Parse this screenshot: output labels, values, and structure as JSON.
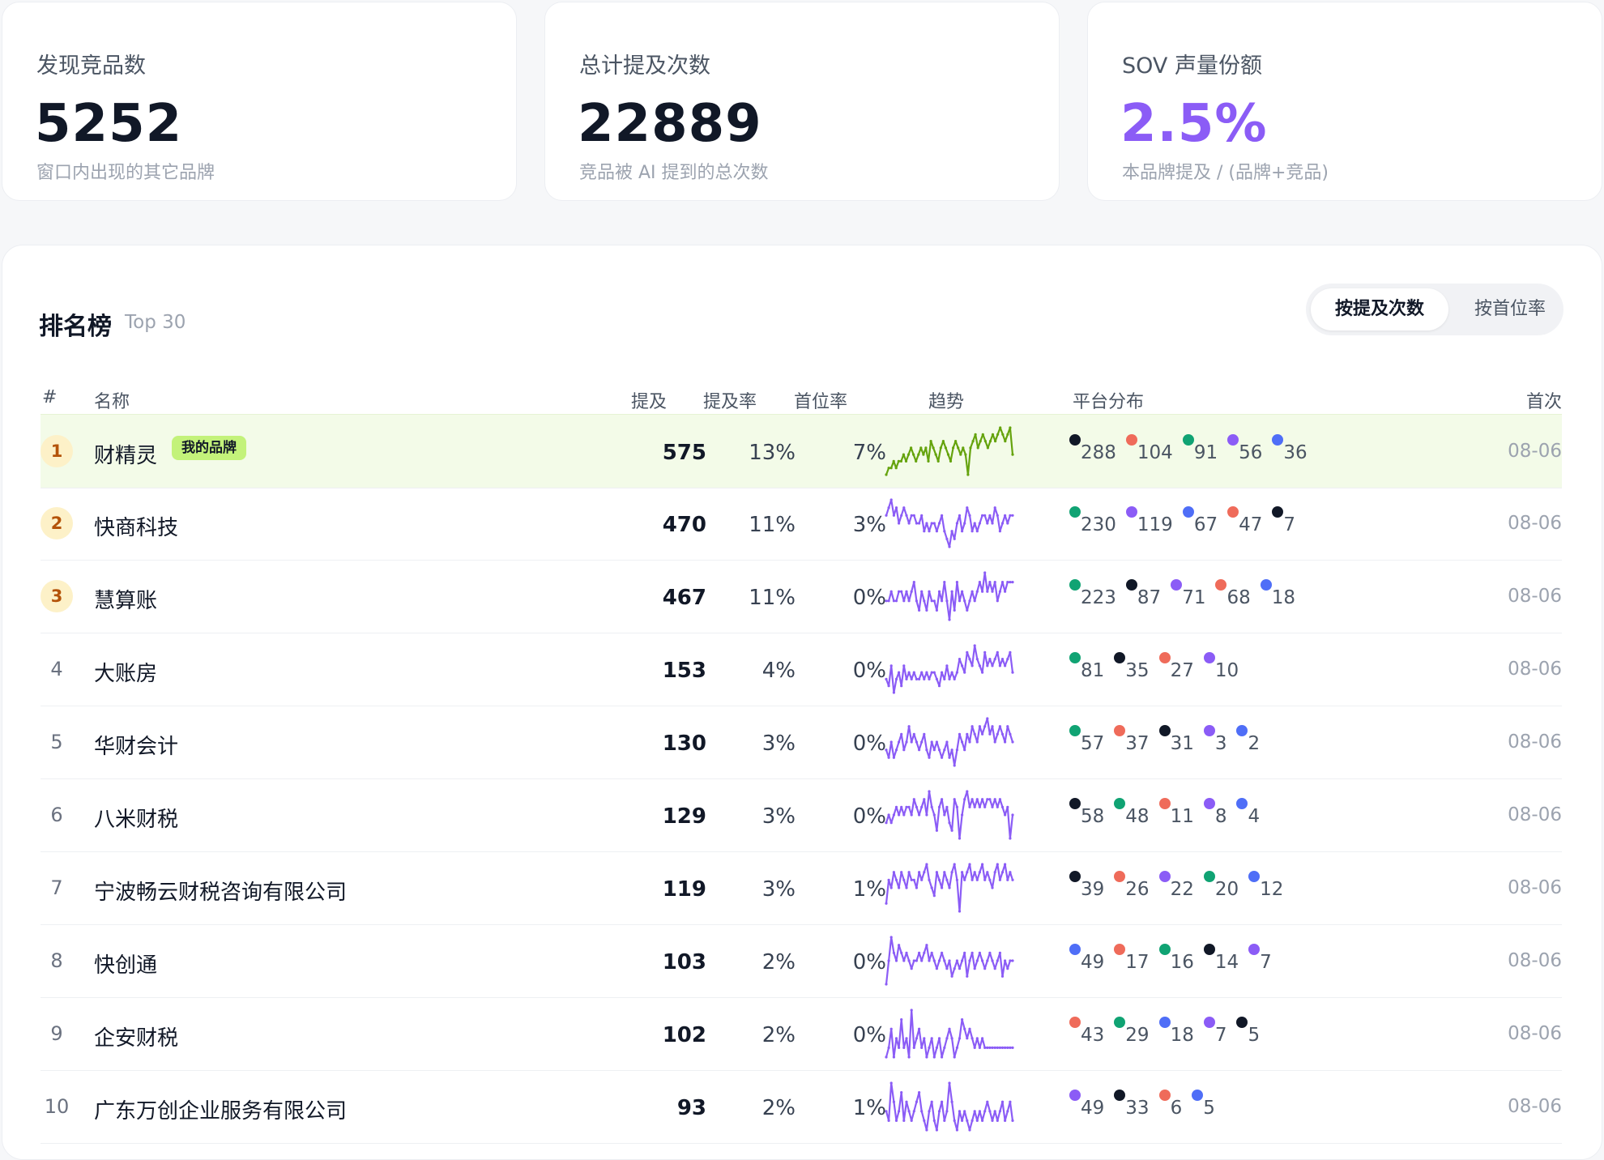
{
  "colors": {
    "black": "#111827",
    "red": "#ef6b5a",
    "green": "#10a373",
    "purple": "#8b5cf6",
    "blue": "#4f6ef7",
    "accent": "#8b5cf6",
    "my_brand_line": "#65a30d",
    "other_line": "#8b5cf6"
  },
  "stats": [
    {
      "label": "发现竞品数",
      "value": "5252",
      "sub": "窗口内出现的其它品牌"
    },
    {
      "label": "总计提及次数",
      "value": "22889",
      "sub": "竞品被 AI 提到的总次数"
    },
    {
      "label": "SOV 声量份额",
      "value": "2.5%",
      "sub": "本品牌提及 / (品牌+竞品)"
    }
  ],
  "ranking": {
    "title": "排名榜",
    "tag": "Top 30",
    "sort_options": [
      "按提及次数",
      "按首位率"
    ],
    "headers": {
      "rank": "#",
      "name": "名称",
      "mentions": "提及",
      "rate": "提及率",
      "first_rate": "首位率",
      "trend": "趋势",
      "platforms": "平台分布",
      "first": "首次"
    },
    "my_brand_badge": "我的品牌",
    "rows": [
      {
        "rank": "1",
        "name": "财精灵",
        "mine": true,
        "mentions": "575",
        "rate": "13%",
        "first_rate": "7%",
        "date": "08-06",
        "trend": [
          3,
          4,
          4,
          5,
          4,
          5,
          5,
          6,
          5,
          6,
          7,
          6,
          5,
          6,
          7,
          6,
          7,
          5,
          8,
          7,
          6,
          5,
          7,
          8,
          7,
          6,
          5,
          7,
          8,
          7,
          6,
          7,
          6,
          3,
          7,
          8,
          9,
          7,
          8,
          9,
          8,
          7,
          8,
          9,
          8,
          9,
          10,
          9,
          8,
          9,
          10,
          6
        ],
        "platforms": [
          {
            "c": "black",
            "v": "288"
          },
          {
            "c": "red",
            "v": "104"
          },
          {
            "c": "green",
            "v": "91"
          },
          {
            "c": "purple",
            "v": "56"
          },
          {
            "c": "blue",
            "v": "36"
          }
        ]
      },
      {
        "rank": "2",
        "name": "快商科技",
        "mentions": "470",
        "rate": "11%",
        "first_rate": "3%",
        "date": "08-06",
        "trend": [
          7,
          8,
          9,
          7,
          8,
          6,
          7,
          8,
          7,
          6,
          7,
          7,
          6,
          6,
          7,
          5,
          6,
          5,
          6,
          6,
          5,
          6,
          7,
          5,
          4,
          3,
          5,
          4,
          6,
          7,
          5,
          6,
          8,
          7,
          5,
          6,
          5,
          6,
          7,
          7,
          6,
          7,
          6,
          8,
          7,
          5,
          6,
          7,
          6,
          7,
          7
        ],
        "platforms": [
          {
            "c": "green",
            "v": "230"
          },
          {
            "c": "purple",
            "v": "119"
          },
          {
            "c": "blue",
            "v": "67"
          },
          {
            "c": "red",
            "v": "47"
          },
          {
            "c": "black",
            "v": "7"
          }
        ]
      },
      {
        "rank": "3",
        "name": "慧算账",
        "mentions": "467",
        "rate": "11%",
        "first_rate": "0%",
        "date": "08-06",
        "trend": [
          6,
          6,
          7,
          6,
          6,
          7,
          7,
          6,
          7,
          6,
          7,
          8,
          6,
          5,
          7,
          6,
          5,
          7,
          6,
          6,
          5,
          7,
          6,
          8,
          6,
          4,
          7,
          5,
          8,
          6,
          7,
          6,
          5,
          6,
          7,
          6,
          7,
          8,
          7,
          9,
          7,
          8,
          7,
          8,
          6,
          7,
          8,
          7,
          8,
          8,
          8
        ],
        "platforms": [
          {
            "c": "green",
            "v": "223"
          },
          {
            "c": "black",
            "v": "87"
          },
          {
            "c": "purple",
            "v": "71"
          },
          {
            "c": "red",
            "v": "68"
          },
          {
            "c": "blue",
            "v": "18"
          }
        ]
      },
      {
        "rank": "4",
        "name": "大账房",
        "mentions": "153",
        "rate": "4%",
        "first_rate": "0%",
        "date": "08-06",
        "trend": [
          5,
          4,
          7,
          3,
          5,
          6,
          4,
          7,
          5,
          6,
          5,
          6,
          5,
          5,
          6,
          5,
          6,
          5,
          6,
          6,
          5,
          4,
          6,
          5,
          7,
          5,
          6,
          5,
          6,
          8,
          7,
          6,
          9,
          8,
          7,
          10,
          8,
          7,
          6,
          9,
          7,
          8,
          7,
          8,
          9,
          7,
          8,
          7,
          8,
          9,
          6
        ],
        "platforms": [
          {
            "c": "green",
            "v": "81"
          },
          {
            "c": "black",
            "v": "35"
          },
          {
            "c": "red",
            "v": "27"
          },
          {
            "c": "purple",
            "v": "10"
          }
        ]
      },
      {
        "rank": "5",
        "name": "华财会计",
        "mentions": "130",
        "rate": "3%",
        "first_rate": "0%",
        "date": "08-06",
        "trend": [
          6,
          5,
          7,
          5,
          6,
          7,
          8,
          6,
          7,
          9,
          7,
          8,
          7,
          6,
          7,
          8,
          6,
          5,
          7,
          6,
          7,
          6,
          5,
          6,
          7,
          5,
          6,
          4,
          6,
          8,
          7,
          6,
          8,
          7,
          9,
          8,
          7,
          9,
          8,
          9,
          10,
          8,
          9,
          7,
          8,
          9,
          8,
          7,
          9,
          8,
          7
        ],
        "platforms": [
          {
            "c": "green",
            "v": "57"
          },
          {
            "c": "red",
            "v": "37"
          },
          {
            "c": "black",
            "v": "31"
          },
          {
            "c": "purple",
            "v": "3"
          },
          {
            "c": "blue",
            "v": "2"
          }
        ]
      },
      {
        "rank": "6",
        "name": "八米财税",
        "mentions": "129",
        "rate": "3%",
        "first_rate": "0%",
        "date": "08-06",
        "trend": [
          6,
          7,
          6,
          7,
          8,
          7,
          8,
          7,
          8,
          8,
          7,
          9,
          8,
          7,
          8,
          9,
          7,
          10,
          8,
          7,
          5,
          8,
          9,
          7,
          8,
          6,
          5,
          9,
          8,
          4,
          7,
          9,
          10,
          8,
          9,
          8,
          9,
          8,
          9,
          8,
          9,
          9,
          8,
          9,
          8,
          9,
          8,
          7,
          8,
          4,
          7
        ],
        "platforms": [
          {
            "c": "black",
            "v": "58"
          },
          {
            "c": "green",
            "v": "48"
          },
          {
            "c": "red",
            "v": "11"
          },
          {
            "c": "purple",
            "v": "8"
          },
          {
            "c": "blue",
            "v": "4"
          }
        ]
      },
      {
        "rank": "7",
        "name": "宁波畅云财税咨询有限公司",
        "mentions": "119",
        "rate": "3%",
        "first_rate": "1%",
        "date": "08-06",
        "trend": [
          5,
          8,
          7,
          9,
          8,
          7,
          9,
          8,
          7,
          9,
          8,
          8,
          7,
          9,
          8,
          9,
          10,
          8,
          7,
          6,
          9,
          8,
          7,
          9,
          8,
          7,
          9,
          10,
          8,
          4,
          9,
          8,
          9,
          10,
          8,
          9,
          8,
          9,
          10,
          8,
          9,
          8,
          7,
          9,
          10,
          8,
          9,
          10,
          8,
          9,
          8
        ],
        "platforms": [
          {
            "c": "black",
            "v": "39"
          },
          {
            "c": "red",
            "v": "26"
          },
          {
            "c": "purple",
            "v": "22"
          },
          {
            "c": "green",
            "v": "20"
          },
          {
            "c": "blue",
            "v": "12"
          }
        ]
      },
      {
        "rank": "8",
        "name": "快创通",
        "mentions": "103",
        "rate": "2%",
        "first_rate": "0%",
        "date": "08-06",
        "trend": [
          4,
          7,
          10,
          8,
          7,
          9,
          8,
          7,
          8,
          7,
          6,
          7,
          7,
          8,
          7,
          8,
          9,
          7,
          8,
          7,
          6,
          7,
          8,
          7,
          6,
          7,
          5,
          6,
          7,
          6,
          7,
          8,
          5,
          7,
          8,
          6,
          7,
          8,
          7,
          6,
          7,
          8,
          7,
          6,
          7,
          8,
          5,
          7,
          6,
          7,
          7
        ],
        "platforms": [
          {
            "c": "blue",
            "v": "49"
          },
          {
            "c": "red",
            "v": "17"
          },
          {
            "c": "green",
            "v": "16"
          },
          {
            "c": "black",
            "v": "14"
          },
          {
            "c": "purple",
            "v": "7"
          }
        ]
      },
      {
        "rank": "9",
        "name": "企安财税",
        "mentions": "102",
        "rate": "2%",
        "first_rate": "0%",
        "date": "08-06",
        "trend": [
          5,
          6,
          8,
          5,
          7,
          6,
          9,
          6,
          7,
          5,
          10,
          6,
          7,
          8,
          6,
          7,
          5,
          6,
          7,
          5,
          6,
          7,
          5,
          6,
          7,
          8,
          7,
          5,
          6,
          7,
          9,
          8,
          7,
          8,
          7,
          6,
          7,
          6,
          7,
          6,
          6,
          6,
          6,
          6,
          6,
          6,
          6,
          6,
          6,
          6,
          6
        ],
        "platforms": [
          {
            "c": "red",
            "v": "43"
          },
          {
            "c": "green",
            "v": "29"
          },
          {
            "c": "blue",
            "v": "18"
          },
          {
            "c": "purple",
            "v": "7"
          },
          {
            "c": "black",
            "v": "5"
          }
        ]
      },
      {
        "rank": "10",
        "name": "广东万创企业服务有限公司",
        "mentions": "93",
        "rate": "2%",
        "first_rate": "1%",
        "date": "08-06",
        "trend": [
          7,
          6,
          10,
          8,
          6,
          7,
          9,
          6,
          8,
          7,
          6,
          7,
          8,
          9,
          7,
          6,
          5,
          7,
          8,
          6,
          5,
          7,
          8,
          6,
          7,
          10,
          8,
          6,
          5,
          7,
          6,
          7,
          6,
          5,
          6,
          7,
          6,
          7,
          6,
          7,
          8,
          7,
          6,
          7,
          6,
          7,
          8,
          6,
          7,
          8,
          6
        ],
        "platforms": [
          {
            "c": "purple",
            "v": "49"
          },
          {
            "c": "black",
            "v": "33"
          },
          {
            "c": "red",
            "v": "6"
          },
          {
            "c": "blue",
            "v": "5"
          }
        ]
      }
    ]
  }
}
